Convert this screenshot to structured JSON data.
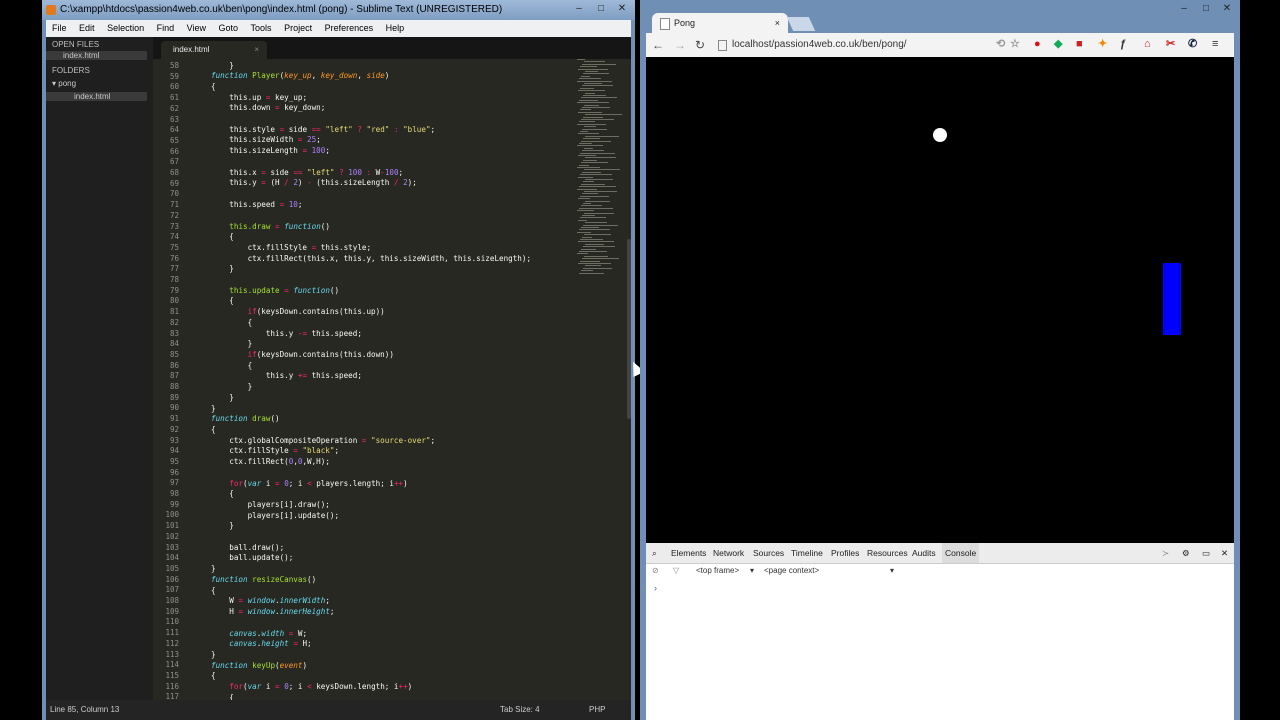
{
  "sublime": {
    "title": "C:\\xampp\\htdocs\\passion4web.co.uk\\ben\\pong\\index.html (pong) - Sublime Text (UNREGISTERED)",
    "menu": [
      "File",
      "Edit",
      "Selection",
      "Find",
      "View",
      "Goto",
      "Tools",
      "Project",
      "Preferences",
      "Help"
    ],
    "sidebar": {
      "open_files_header": "OPEN FILES",
      "open_file": "index.html",
      "folders_header": "FOLDERS",
      "folder": "pong",
      "folder_file": "index.html"
    },
    "tab_label": "index.html",
    "tab_close": "×",
    "line_numbers": [
      58,
      59,
      60,
      61,
      62,
      63,
      64,
      65,
      66,
      67,
      68,
      69,
      70,
      71,
      72,
      73,
      74,
      75,
      76,
      77,
      78,
      79,
      80,
      81,
      82,
      83,
      84,
      85,
      86,
      87,
      88,
      89,
      90,
      91,
      92,
      93,
      94,
      95,
      96,
      97,
      98,
      99,
      100,
      101,
      102,
      103,
      104,
      105,
      106,
      107,
      108,
      109,
      110,
      111,
      112,
      113,
      114,
      115,
      116,
      117
    ],
    "status_left": "Line 85, Column 13",
    "status_tab": "Tab Size: 4",
    "status_syntax": "PHP"
  },
  "chrome": {
    "tab_title": "Pong",
    "tab_close": "×",
    "url": "localhost/passion4web.co.uk/ben/pong/",
    "devtools_tabs": [
      "Elements",
      "Network",
      "Sources",
      "Timeline",
      "Profiles",
      "Resources",
      "Audits",
      "Console"
    ],
    "frame_select": "<top frame>",
    "context_select": "<page context>",
    "console_prompt": "›"
  },
  "colors": {
    "editor_bg": "#272822",
    "paddle": "#0000ff",
    "ball": "#ffffff"
  }
}
